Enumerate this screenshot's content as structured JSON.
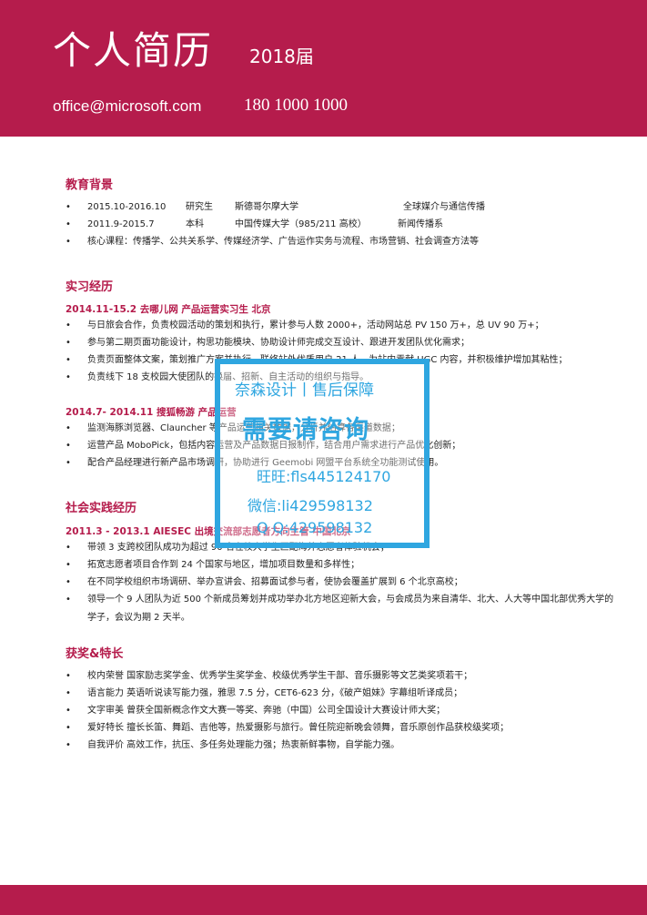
{
  "header": {
    "name": "个人简历",
    "year": "2018届",
    "email": "office@microsoft.com",
    "phone": "180 1000 1000"
  },
  "colors": {
    "accent": "#b51c4c",
    "watermark": "#2fa6e0"
  },
  "education": {
    "title": "教育背景",
    "rows": [
      {
        "period": "2015.10-2016.10",
        "degree": "研究生",
        "school": "斯德哥尔摩大学",
        "major": "全球媒介与通信传播"
      },
      {
        "period": "2011.9-2015.7",
        "degree": "本科",
        "school": "中国传媒大学（985/211 高校）",
        "major": "新闻传播系"
      }
    ],
    "courses": "核心课程：传播学、公共关系学、传媒经济学、广告运作实务与流程、市场营销、社会调查方法等"
  },
  "internship": {
    "title": "实习经历",
    "jobs": [
      {
        "heading": "2014.11-15.2 去哪儿网 产品运营实习生 北京",
        "items": [
          "与日旅会合作，负责校园活动的策划和执行，累计参与人数 2000+，活动网站总 PV 150 万+，总 UV 90 万+；",
          "参与第二期页面功能设计，构思功能模块、协助设计师完成交互设计、跟进开发团队优化需求；",
          "负责页面整体文案，策划推广方案并执行，联络站外优质用户 21 人，为站内贡献 UGC 内容，并积极维护增加其粘性；",
          "负责线下 18 支校园大使团队的换届、招新、自主活动的组织与指导。"
        ]
      },
      {
        "heading": "2014.7- 2014.11 搜狐畅游 产品运营",
        "items": [
          "监测海豚浏览器、Clauncher 等产品运营相关数据，分析并估算各渠道数据；",
          "运营产品 MoboPick，包括内容运营及产品数据日报制作，结合用户需求进行产品优化创新；",
          "配合产品经理进行新产品市场调研，协助进行 Geemobi 网盟平台系统全功能测试使用。"
        ]
      }
    ]
  },
  "social": {
    "title": "社会实践经历",
    "heading": "2011.3 - 2013.1 AIESEC 出境交流部志愿者方向主管 中国北京",
    "items": [
      "带领 3 支跨校团队成功为超过 90 名在校大学生匹配海外志愿者体验机会；",
      "拓宽志愿者项目合作到 24 个国家与地区，增加项目数量和多样性；",
      "在不同学校组织市场调研、举办宣讲会、招募面试参与者，使协会覆盖扩展到 6 个北京高校；",
      "领导一个 9 人团队为近 500 个新成员筹划并成功举办北方地区迎新大会，与会成员为来自清华、北大、人大等中国北部优秀大学的学子，会议为期 2 天半。"
    ]
  },
  "awards": {
    "title": "获奖&特长",
    "items": [
      "校内荣誉 国家励志奖学金、优秀学生奖学金、校级优秀学生干部、音乐摄影等文艺类奖项若干；",
      "语言能力 英语听说读写能力强，雅思 7.5 分，CET6-623 分，《破产姐妹》字幕组听译成员；",
      "文字审美 曾获全国新概念作文大赛一等奖、奔驰（中国）公司全国设计大赛设计师大奖；",
      "爱好特长 擅长长笛、舞蹈、吉他等，热爱摄影与旅行。曾任院迎新晚会领舞，音乐原创作品获校级奖项；",
      "自我评价 高效工作，抗压、多任务处理能力强；热衷新鲜事物，自学能力强。"
    ]
  },
  "watermark": {
    "line1": "奈森设计丨售后保障",
    "line2": "需要请咨询",
    "line3": "旺旺:fls445124170",
    "line4": "微信:li429598132",
    "line5": "Q Q:429598132"
  },
  "bullet": "•"
}
